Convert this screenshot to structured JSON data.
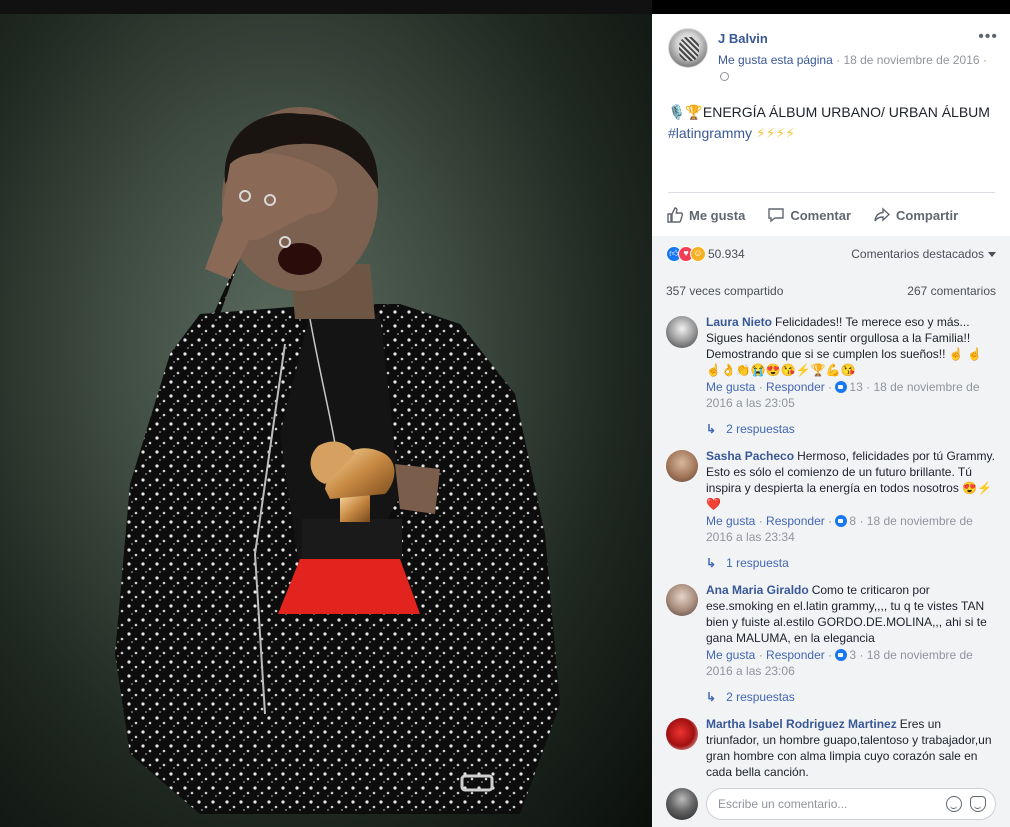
{
  "post": {
    "page_name": "J Balvin",
    "like_page": "Me gusta esta página",
    "separator": "·",
    "date": "18 de noviembre de 2016",
    "separator2": "·",
    "more": "•••",
    "text_prefix_emoji": "🎙️🏆",
    "text": "ENERGÍA ÁLBUM URBANO/ URBAN ÁLBUM",
    "hashtag": "#latingrammy",
    "text_suffix_emoji": "⚡⚡⚡⚡"
  },
  "actions": {
    "like": "Me gusta",
    "comment": "Comentar",
    "share": "Compartir"
  },
  "stats": {
    "reactions_count": "50.934",
    "featured_comments": "Comentarios destacados",
    "shares": "357 veces compartido",
    "comments": "267 comentarios"
  },
  "comments": [
    {
      "author": "Laura Nieto",
      "text": "Felicidades!! Te merece eso y más... Sigues haciéndonos sentir orgullosa a la Familia!! Demostrando que si se cumplen los sueños!! ☝ ☝☝👌👏😭😍😘⚡🏆💪😘",
      "like": "Me gusta",
      "reply": "Responder",
      "likes": "13",
      "time": "18 de noviembre de 2016 a las 23:05",
      "replies": "2 respuestas"
    },
    {
      "author": "Sasha Pacheco",
      "text": "Hermoso, felicidades por tú Grammy. Esto es sólo el comienzo de un futuro brillante. Tú inspira y despierta la energía en todos nosotros 😍⚡❤️",
      "like": "Me gusta",
      "reply": "Responder",
      "likes": "8",
      "time": "18 de noviembre de 2016 a las 23:34",
      "replies": "1 respuesta"
    },
    {
      "author": "Ana Maria Giraldo",
      "text": "Como te criticaron por ese.smoking en el.latin grammy,,,, tu q te vistes TAN bien y fuiste al.estilo GORDO.DE.MOLINA,,, ahi si te gana MALUMA, en la elegancia",
      "like": "Me gusta",
      "reply": "Responder",
      "likes": "3",
      "time": "18 de noviembre de 2016 a las 23:06",
      "replies": "2 respuestas"
    },
    {
      "author": "Martha Isabel Rodriguez Martinez",
      "text": "Eres un triunfador, un hombre guapo,talentoso y trabajador,un gran hombre con alma limpia cuyo corazón sale en cada bella canción."
    }
  ],
  "compose": {
    "placeholder": "Escribe un comentario..."
  },
  "colors": {
    "link": "#385898",
    "meta": "#90949c",
    "panel_bg": "#f2f3f5"
  }
}
